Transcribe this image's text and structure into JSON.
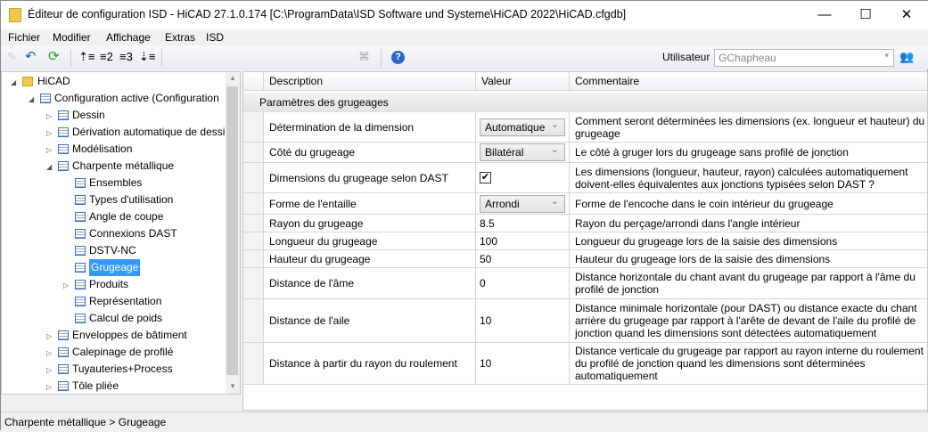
{
  "window": {
    "title": "Éditeur de configuration ISD  - HiCAD 27.1.0.174 [C:\\ProgramData\\ISD Software und Systeme\\HiCAD 2022\\HiCAD.cfgdb]",
    "minimize": "—",
    "maximize": "☐",
    "close": "✕"
  },
  "menu": [
    "Fichier",
    "Modifier",
    "Affichage",
    "Extras",
    "ISD"
  ],
  "toolbar": {
    "level2": "2",
    "level3": "3",
    "user_label": "Utilisateur",
    "user_value": "GChapheau"
  },
  "tree": [
    {
      "label": "HiCAD",
      "expanded": true
    },
    {
      "label": "Configuration active (Configuration",
      "expanded": true
    },
    {
      "label": "Dessin"
    },
    {
      "label": "Dérivation automatique de dessi"
    },
    {
      "label": "Modélisation"
    },
    {
      "label": "Charpente métallique",
      "expanded": true
    },
    {
      "label": "Ensembles"
    },
    {
      "label": "Types d'utilisation"
    },
    {
      "label": "Angle de coupe"
    },
    {
      "label": "Connexions DAST"
    },
    {
      "label": "DSTV-NC"
    },
    {
      "label": "Grugeage",
      "selected": true
    },
    {
      "label": "Produits"
    },
    {
      "label": "Représentation"
    },
    {
      "label": "Calcul de poids"
    },
    {
      "label": "Enveloppes de bâtiment"
    },
    {
      "label": "Calepinage de profilé"
    },
    {
      "label": "Tuyauteries+Process"
    },
    {
      "label": "Tôle pliée"
    }
  ],
  "grid": {
    "headers": {
      "description": "Description",
      "value": "Valeur",
      "comment": "Commentaire"
    },
    "group": "Paramètres des grugeages",
    "rows": [
      {
        "description": "Détermination de la dimension",
        "value": "Automatique",
        "type": "combo",
        "comment": "Comment seront déterminées les dimensions (ex. longueur et hauteur) du grugeage"
      },
      {
        "description": "Côté du grugeage",
        "value": "Bilatéral",
        "type": "combo",
        "comment": "Le côté à gruger lors du grugeage sans profilé de jonction"
      },
      {
        "description": "Dimensions du grugeage selon DAST",
        "value": "✔",
        "type": "check",
        "comment": "Les dimensions (longueur, hauteur, rayon) calculées automatiquement doivent-elles équivalentes aux jonctions typisées selon DAST ?"
      },
      {
        "description": "Forme de l'entaille",
        "value": "Arrondi",
        "type": "combo",
        "comment": "Forme de l'encoche dans le coin intérieur du grugeage"
      },
      {
        "description": "Rayon du grugeage",
        "value": "8.5",
        "type": "text",
        "comment": "Rayon du perçage/arrondi dans l'angle intérieur"
      },
      {
        "description": "Longueur du grugeage",
        "value": "100",
        "type": "text",
        "comment": "Longueur du grugeage lors de la saisie des dimensions"
      },
      {
        "description": "Hauteur du grugeage",
        "value": "50",
        "type": "text",
        "comment": "Hauteur du grugeage lors de la saisie des dimensions"
      },
      {
        "description": "Distance de l'âme",
        "value": "0",
        "type": "text",
        "comment": "Distance horizontale du chant avant du grugeage par rapport à l'âme du profilé de jonction"
      },
      {
        "description": "Distance de l'aile",
        "value": "10",
        "type": "text",
        "comment": "Distance minimale horizontale (pour DAST) ou distance exacte du chant arrière du grugeage par rapport à l'arête de devant de l'aile du profilé de jonction quand les dimensions sont détectées automatiquement"
      },
      {
        "description": "Distance à partir du rayon du roulement",
        "value": "10",
        "type": "text",
        "comment": "Distance verticale du grugeage par rapport au rayon interne du roulement du profilé de jonction quand les dimensions sont déterminées automatiquement"
      }
    ]
  },
  "status": "Charpente métallique > Grugeage"
}
